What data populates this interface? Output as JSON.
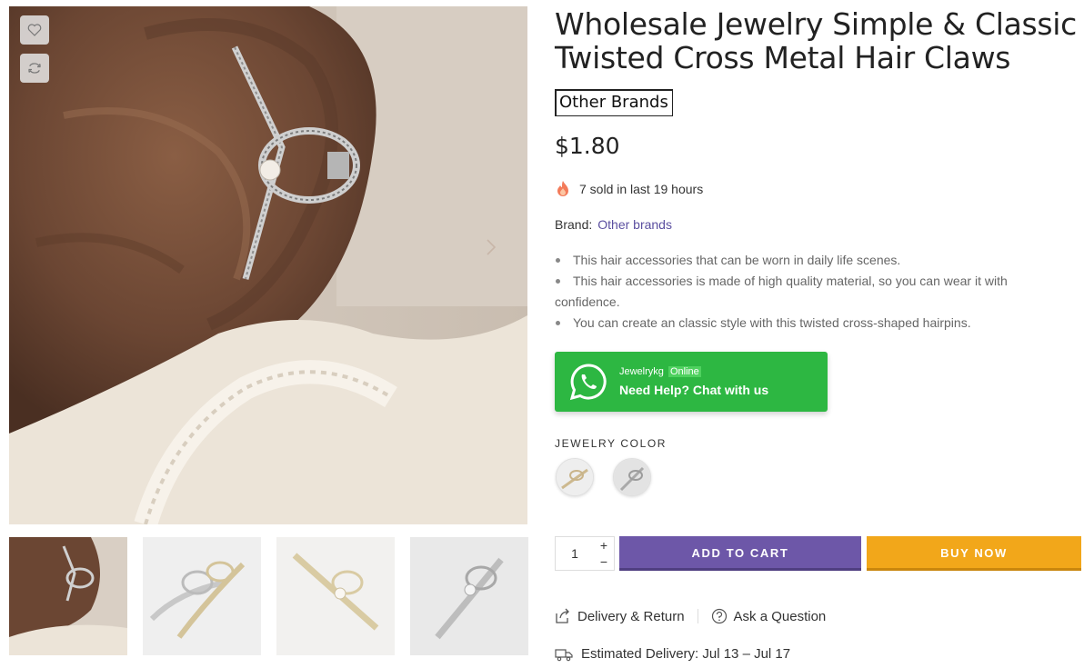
{
  "product": {
    "title": "Wholesale Jewelry Simple & Classic Twisted Cross Metal Hair Claws",
    "brand_badge": "Other Brands",
    "price": "$1.80",
    "sold_text": "7 sold in last 19 hours",
    "brand_label": "Brand:",
    "brand_link": "Other brands",
    "bullets": [
      "This hair accessories that can be worn in daily life scenes.",
      "This hair accessories is made of high quality material, so you can wear it with confidence.",
      "You can create an classic style with this twisted cross-shaped hairpins."
    ]
  },
  "whatsapp": {
    "name": "Jewelrykg",
    "status": "Online",
    "cta": "Need Help? Chat with us",
    "color": "#2db742"
  },
  "variant": {
    "label": "JEWELRY COLOR",
    "options": [
      "gold",
      "silver"
    ]
  },
  "cart": {
    "quantity": "1",
    "plus": "+",
    "minus": "−",
    "add_to_cart": "ADD TO CART",
    "buy_now": "BUY NOW",
    "add_color": "#6d57a8",
    "buy_color": "#f2a71a"
  },
  "links": {
    "delivery_return": "Delivery & Return",
    "ask_question": "Ask a Question"
  },
  "delivery": {
    "text": "Estimated Delivery: Jul 13 – Jul 17"
  },
  "icons": {
    "wishlist": "heart-icon",
    "compare": "refresh-icon",
    "next": "chevron-right-icon",
    "fire": "fire-icon",
    "whatsapp": "whatsapp-icon",
    "share": "share-icon",
    "question": "question-circle-icon",
    "truck": "truck-icon"
  }
}
